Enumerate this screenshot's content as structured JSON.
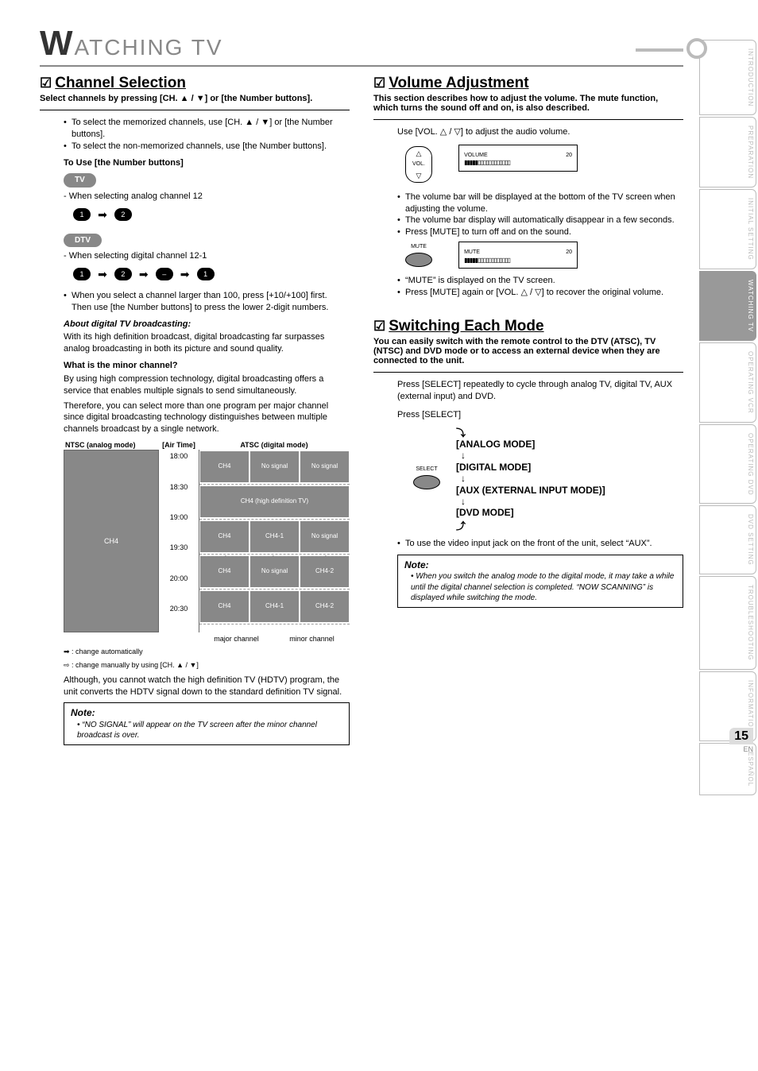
{
  "page_title_prefix": "W",
  "page_title_rest": "ATCHING TV",
  "side_tabs": [
    {
      "label": "INTRODUCTION",
      "active": false
    },
    {
      "label": "PREPARATION",
      "active": false
    },
    {
      "label": "INITIAL SETTING",
      "active": false
    },
    {
      "label": "WATCHING TV",
      "active": true
    },
    {
      "label": "OPERATING VCR",
      "active": false
    },
    {
      "label": "OPERATING DVD",
      "active": false
    },
    {
      "label": "DVD SETTING",
      "active": false
    },
    {
      "label": "TROUBLESHOOTING",
      "active": false
    },
    {
      "label": "INFORMATION",
      "active": false
    },
    {
      "label": "ESPAÑOL",
      "active": false
    }
  ],
  "page_number": "15",
  "page_lang": "EN",
  "left": {
    "section_title": "Channel Selection",
    "intro": "Select channels by pressing [CH. ▲ / ▼] or [the Number buttons].",
    "bullets1": [
      "To select the memorized channels, use [CH. ▲ / ▼] or [the Number buttons].",
      "To select the non-memorized channels, use [the Number buttons]."
    ],
    "use_number_title": "To Use [the Number buttons]",
    "tv_pill": "TV",
    "analog_example_label": "- When selecting analog channel 12",
    "analog_digits": [
      "1",
      "2"
    ],
    "dtv_pill": "DTV",
    "digital_example_label": "- When selecting digital channel 12-1",
    "digital_digits": [
      "1",
      "2",
      "–",
      "1"
    ],
    "over100_lines": [
      "When you select a channel larger than 100, press [+10/+100] first.",
      "Then use [the Number buttons] to press the lower 2-digit numbers."
    ],
    "about_title": "About digital TV broadcasting:",
    "about_text": "With its high definition broadcast, digital broadcasting far surpasses analog broadcasting in both its picture and sound quality.",
    "minor_title": "What is the minor channel?",
    "minor_text1": "By using high compression technology, digital broadcasting offers a service that enables multiple signals to send simultaneously.",
    "minor_text2": "Therefore, you can select more than one program per major channel since digital broadcasting technology distinguishes between multiple channels broadcast by a single network.",
    "sched": {
      "ntsc_head": "NTSC (analog mode)",
      "airtime_head": "[Air Time]",
      "atsc_head": "ATSC (digital mode)",
      "times": [
        "18:00",
        "18:30",
        "19:00",
        "19:30",
        "20:00",
        "20:30"
      ],
      "analog_ch": "CH4",
      "hdtv_label": "CH4 (high definition TV)",
      "cells": {
        "r1": [
          "CH4",
          "No signal",
          "No signal"
        ],
        "r3": [
          "CH4",
          "CH4-1",
          "No signal"
        ],
        "r4": [
          "CH4",
          "No signal",
          "CH4-2"
        ],
        "r5": [
          "CH4",
          "CH4-1",
          "CH4-2"
        ]
      },
      "major_label": "major channel",
      "minor_label": "minor channel",
      "legend_auto": ": change automatically",
      "legend_manual": ": change manually by using [CH. ▲ / ▼]"
    },
    "hdtv_note": "Although, you cannot watch the high definition TV (HDTV) program, the unit converts the HDTV signal down to the standard definition TV signal.",
    "note_title": "Note:",
    "note_text": "“NO SIGNAL” will appear on the TV screen after the minor channel broadcast is over."
  },
  "right": {
    "vol_title": "Volume Adjustment",
    "vol_intro": "This section describes how to adjust the volume. The mute function, which turns the sound off and on, is also described.",
    "vol_use": "Use [VOL. △ / ▽] to adjust the audio volume.",
    "vol_btn_label": "VOL.",
    "vol_osd_label": "VOLUME",
    "vol_osd_value": "20",
    "vol_bullets": [
      "The volume bar will be displayed at the bottom of the TV screen when adjusting the volume.",
      "The volume bar display will automatically disappear in a few seconds.",
      "Press [MUTE] to turn off and on the sound."
    ],
    "mute_btn_label": "MUTE",
    "mute_osd_label": "MUTE",
    "mute_osd_value": "20",
    "mute_bullets": [
      "“MUTE” is displayed on the TV screen.",
      "Press [MUTE] again or [VOL. △ / ▽] to recover the original volume."
    ],
    "switch_title": "Switching Each Mode",
    "switch_intro": "You can easily switch with the remote control to the DTV (ATSC), TV (NTSC) and DVD mode or to access an external device when they are connected to the unit.",
    "switch_press1": "Press [SELECT] repeatedly to cycle through analog TV, digital TV, AUX (external input) and DVD.",
    "switch_press2": "Press [SELECT]",
    "select_btn_label": "SELECT",
    "modes": [
      "[ANALOG MODE]",
      "[DIGITAL MODE]",
      "[AUX (EXTERNAL INPUT MODE)]",
      "[DVD MODE]"
    ],
    "switch_bullet": "To use the video input jack on the front of the unit, select “AUX”.",
    "note_title": "Note:",
    "note_text": "When you switch the analog mode to the digital mode, it may take a while until the digital channel selection is completed. “NOW SCANNING” is displayed while switching the mode."
  }
}
